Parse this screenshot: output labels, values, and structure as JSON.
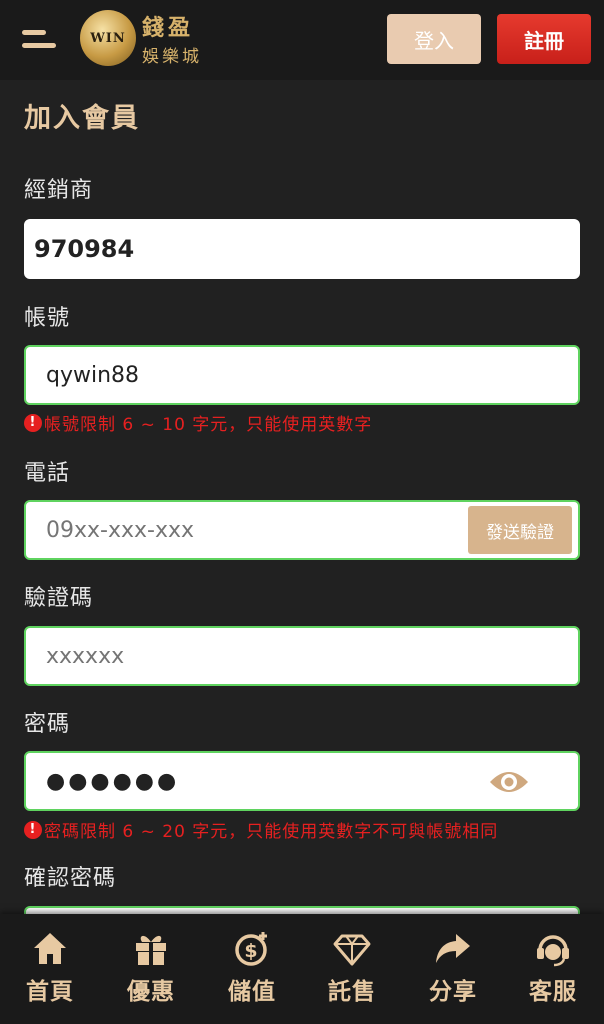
{
  "header": {
    "menu_icon": "menu-icon",
    "brand_name": "錢盈",
    "brand_sub": "娛樂城",
    "logo_mark": "WIN",
    "login_label": "登入",
    "register_label": "註冊"
  },
  "form": {
    "title": "加入會員",
    "dealer": {
      "label": "經銷商",
      "value": "970984"
    },
    "account": {
      "label": "帳號",
      "value": "qywin88",
      "hint": "帳號限制 6 ~ 10 字元，只能使用英數字"
    },
    "phone": {
      "label": "電話",
      "placeholder": "09xx-xxx-xxx",
      "send_code_label": "發送驗證"
    },
    "verify": {
      "label": "驗證碼",
      "placeholder": "xxxxxx"
    },
    "password": {
      "label": "密碼",
      "value": "●●●●●●",
      "hint": "密碼限制 6 ~ 20 字元，只能使用英數字不可與帳號相同"
    },
    "confirm": {
      "label": "確認密碼"
    }
  },
  "nav": [
    {
      "label": "首頁",
      "icon": "home-icon"
    },
    {
      "label": "優惠",
      "icon": "gift-icon"
    },
    {
      "label": "儲值",
      "icon": "deposit-icon"
    },
    {
      "label": "託售",
      "icon": "diamond-icon"
    },
    {
      "label": "分享",
      "icon": "share-icon"
    },
    {
      "label": "客服",
      "icon": "support-icon"
    }
  ],
  "colors": {
    "accent": "#e7c9a2",
    "error": "#e62020",
    "valid": "#5fd35f",
    "register": "#d8271e"
  }
}
